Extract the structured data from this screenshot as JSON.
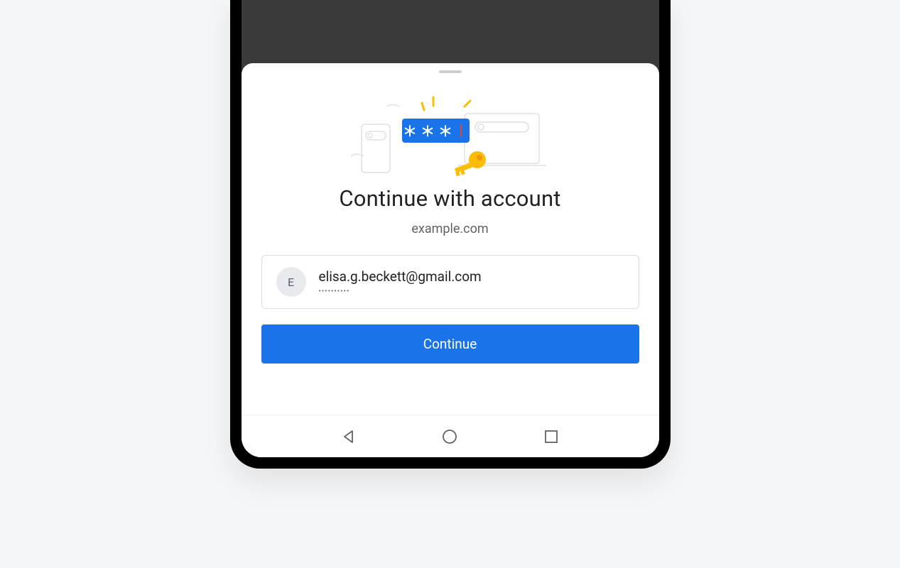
{
  "sheet": {
    "title": "Continue with account",
    "domain": "example.com",
    "continue_label": "Continue"
  },
  "account": {
    "avatar_initial": "E",
    "email": "elisa.g.beckett@gmail.com",
    "password_mask": "••••••••••"
  },
  "illustration": {
    "password_mask": "＊ ＊ ＊"
  }
}
